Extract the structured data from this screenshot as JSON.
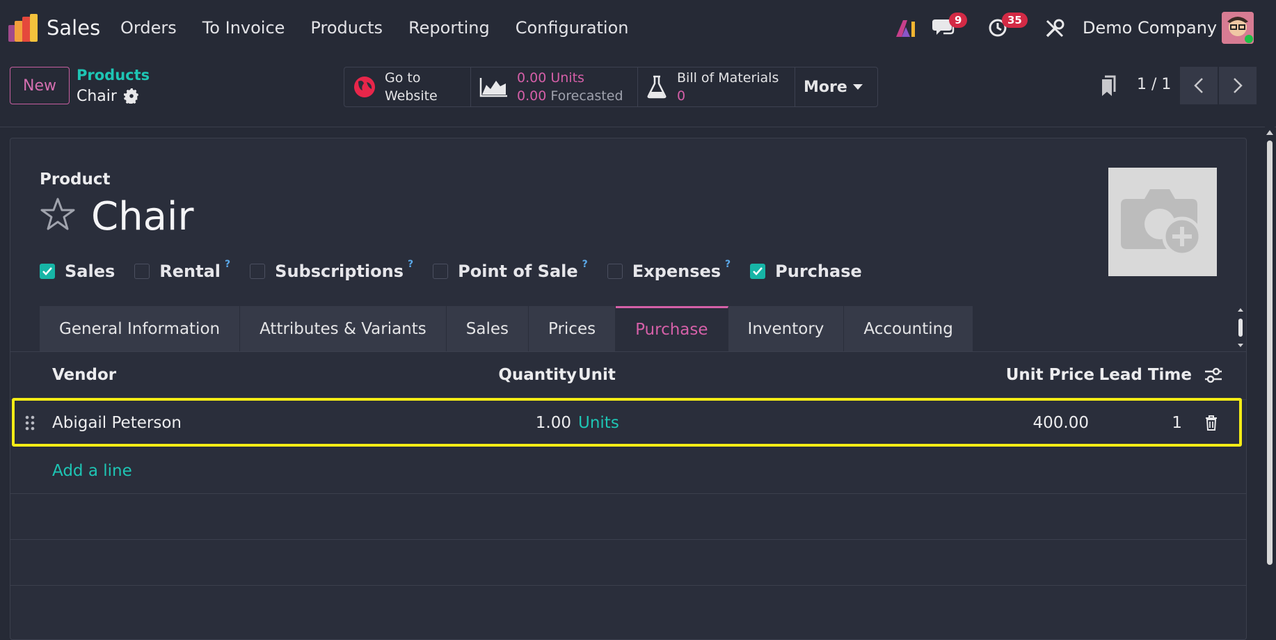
{
  "app": {
    "name": "Sales",
    "menu": [
      "Orders",
      "To Invoice",
      "Products",
      "Reporting",
      "Configuration"
    ],
    "messages_count": "9",
    "activities_count": "35",
    "company": "Demo Company"
  },
  "control": {
    "new_label": "New",
    "breadcrumb_parent": "Products",
    "breadcrumb_current": "Chair",
    "smart_buttons": {
      "website_line1": "Go to",
      "website_line2": "Website",
      "units_value": "0.00",
      "units_label": "Units",
      "forecast_value": "0.00",
      "forecast_label": "Forecasted",
      "bom_label": "Bill of Materials",
      "bom_count": "0",
      "more_label": "More"
    },
    "pager": "1 / 1"
  },
  "form": {
    "product_label": "Product",
    "product_name": "Chair",
    "checkboxes": [
      {
        "label": "Sales",
        "checked": true,
        "help": ""
      },
      {
        "label": "Rental",
        "checked": false,
        "help": "?"
      },
      {
        "label": "Subscriptions",
        "checked": false,
        "help": "?"
      },
      {
        "label": "Point of Sale",
        "checked": false,
        "help": "?"
      },
      {
        "label": "Expenses",
        "checked": false,
        "help": "?"
      },
      {
        "label": "Purchase",
        "checked": true,
        "help": ""
      }
    ],
    "tabs": [
      "General Information",
      "Attributes & Variants",
      "Sales",
      "Prices",
      "Purchase",
      "Inventory",
      "Accounting"
    ],
    "active_tab": "Purchase"
  },
  "vendor_table": {
    "headers": {
      "vendor": "Vendor",
      "quantity": "Quantity",
      "unit": "Unit",
      "unit_price": "Unit Price",
      "lead_time": "Lead Time"
    },
    "rows": [
      {
        "vendor": "Abigail Peterson",
        "quantity": "1.00",
        "unit": "Units",
        "unit_price": "400.00",
        "lead_time": "1"
      }
    ],
    "add_line": "Add a line"
  },
  "colors": {
    "accent": "#d560a8",
    "teal": "#1ec5b4",
    "highlight": "#f4ec16",
    "background": "#262a36"
  }
}
